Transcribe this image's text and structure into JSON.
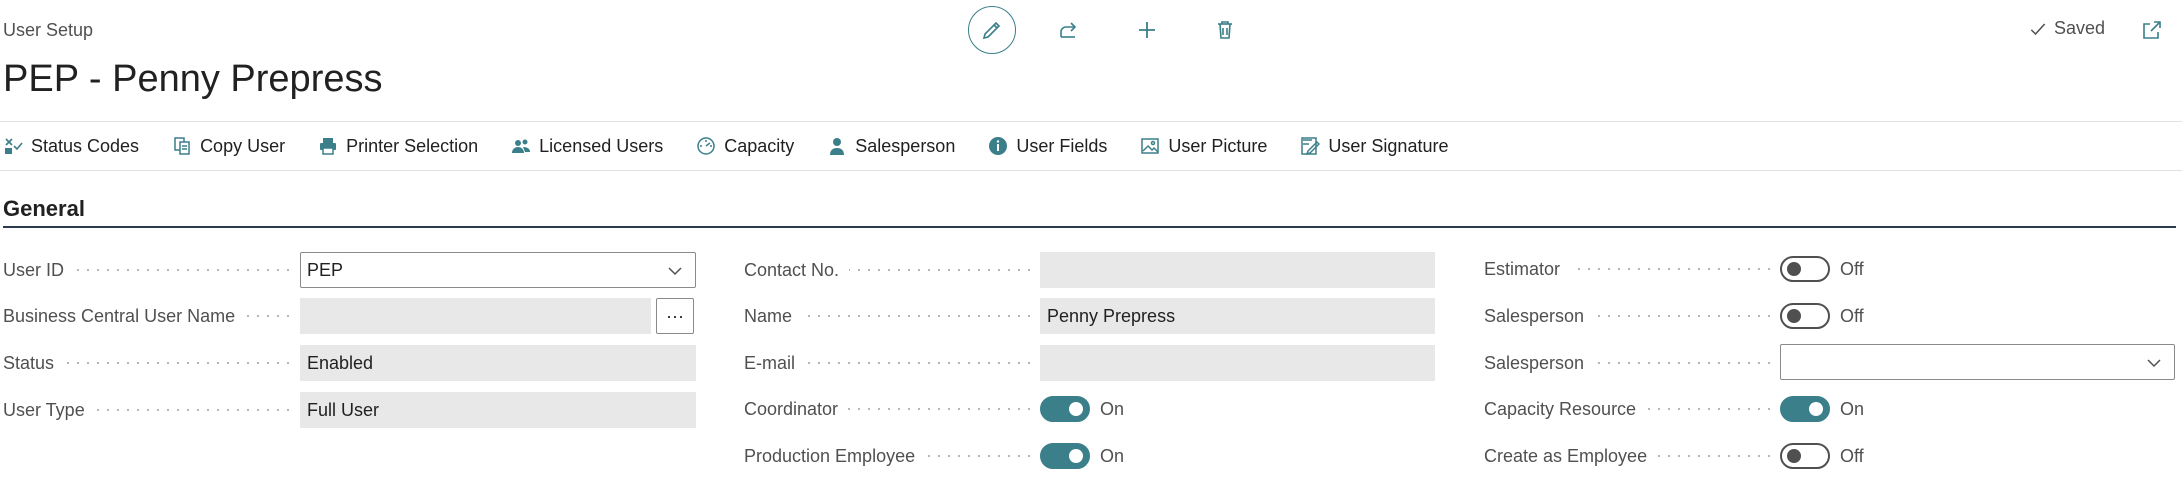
{
  "header": {
    "breadcrumb": "User Setup",
    "title": "PEP - Penny Prepress",
    "saved_label": "Saved",
    "actions": [
      "edit-icon",
      "share-icon",
      "plus-icon",
      "trash-icon"
    ]
  },
  "action_bar": [
    {
      "icon": "status-codes-icon",
      "label": "Status Codes"
    },
    {
      "icon": "copy-icon",
      "label": "Copy User"
    },
    {
      "icon": "printer-icon",
      "label": "Printer Selection"
    },
    {
      "icon": "users-icon",
      "label": "Licensed Users"
    },
    {
      "icon": "gauge-icon",
      "label": "Capacity"
    },
    {
      "icon": "person-icon",
      "label": "Salesperson"
    },
    {
      "icon": "info-icon",
      "label": "User Fields"
    },
    {
      "icon": "image-icon",
      "label": "User Picture"
    },
    {
      "icon": "signature-icon",
      "label": "User Signature"
    }
  ],
  "section": {
    "title": "General"
  },
  "col1": {
    "user_id": {
      "label": "User ID",
      "value": "PEP"
    },
    "bc_user_name": {
      "label": "Business Central User Name",
      "value": "",
      "lookup": "···"
    },
    "status": {
      "label": "Status",
      "value": "Enabled"
    },
    "user_type": {
      "label": "User Type",
      "value": "Full User"
    }
  },
  "col2": {
    "contact_no": {
      "label": "Contact No.",
      "value": ""
    },
    "name": {
      "label": "Name",
      "value": "Penny Prepress"
    },
    "email": {
      "label": "E-mail",
      "value": ""
    },
    "coordinator": {
      "label": "Coordinator",
      "state": "On"
    },
    "production_employee": {
      "label": "Production Employee",
      "state": "On"
    }
  },
  "col3": {
    "estimator": {
      "label": "Estimator",
      "state": "Off"
    },
    "salesperson_toggle": {
      "label": "Salesperson",
      "state": "Off"
    },
    "salesperson_select": {
      "label": "Salesperson",
      "value": ""
    },
    "capacity_resource": {
      "label": "Capacity Resource",
      "state": "On"
    },
    "create_as_employee": {
      "label": "Create as Employee",
      "state": "Off"
    }
  },
  "colors": {
    "accent": "#3a7f8a",
    "field_bg": "#e8e8e9",
    "section_line": "#2b3a4e"
  }
}
